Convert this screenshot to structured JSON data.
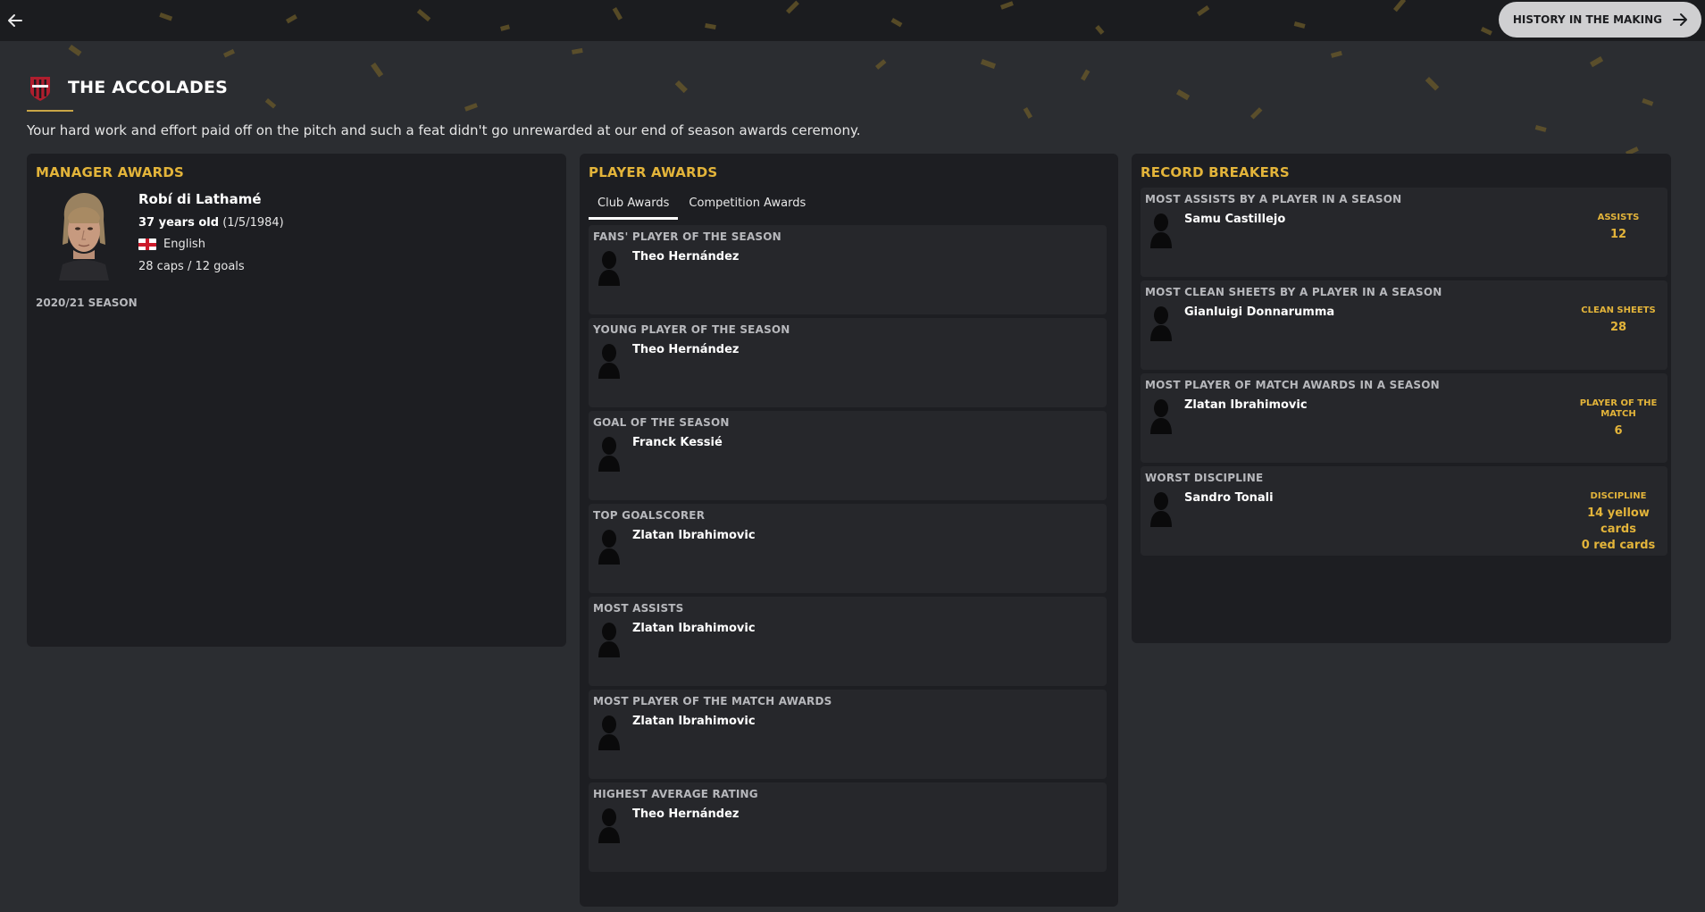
{
  "topbar": {
    "history_button_label": "HISTORY IN THE MAKING"
  },
  "header": {
    "title": "THE ACCOLADES",
    "subtitle": "Your hard work and effort paid off on the pitch and such a feat didn't go unrewarded at our end of season awards ceremony."
  },
  "manager_awards": {
    "title": "MANAGER AWARDS",
    "name": "Robí di Lathamé",
    "age": "37 years old",
    "dob": "(1/5/1984)",
    "nationality": "English",
    "caps_goals": "28 caps / 12 goals",
    "season": "2020/21 SEASON"
  },
  "player_awards": {
    "title": "PLAYER AWARDS",
    "tabs": [
      "Club Awards",
      "Competition Awards"
    ],
    "active_tab": "Club Awards",
    "cards": [
      {
        "label": "FANS' PLAYER OF THE SEASON",
        "player": "Theo Hernández"
      },
      {
        "label": "YOUNG PLAYER OF THE SEASON",
        "player": "Theo Hernández"
      },
      {
        "label": "GOAL OF THE SEASON",
        "player": "Franck Kessié"
      },
      {
        "label": "TOP GOALSCORER",
        "player": "Zlatan Ibrahimovic"
      },
      {
        "label": "MOST ASSISTS",
        "player": "Zlatan Ibrahimovic"
      },
      {
        "label": "MOST PLAYER OF THE MATCH AWARDS",
        "player": "Zlatan Ibrahimovic"
      },
      {
        "label": "HIGHEST AVERAGE RATING",
        "player": "Theo Hernández"
      }
    ]
  },
  "record_breakers": {
    "title": "RECORD BREAKERS",
    "cards": [
      {
        "label": "MOST ASSISTS BY A PLAYER IN A SEASON",
        "player": "Samu Castillejo",
        "stat_label": "ASSISTS",
        "stat_value": "12"
      },
      {
        "label": "MOST CLEAN SHEETS BY A PLAYER IN A SEASON",
        "player": "Gianluigi Donnarumma",
        "stat_label": "CLEAN SHEETS",
        "stat_value": "28"
      },
      {
        "label": "MOST PLAYER OF MATCH AWARDS IN A SEASON",
        "player": "Zlatan Ibrahimovic",
        "stat_label": "PLAYER OF THE MATCH",
        "stat_value": "6"
      },
      {
        "label": "WORST DISCIPLINE",
        "player": "Sandro Tonali",
        "stat_label": "DISCIPLINE",
        "stat_value": "14 yellow cards",
        "stat_value_2": "0 red cards"
      }
    ]
  },
  "colors": {
    "accent_gold": "#e3b43a",
    "background": "#2b2d31",
    "panel": "#1d1e22",
    "card": "#26272b"
  }
}
